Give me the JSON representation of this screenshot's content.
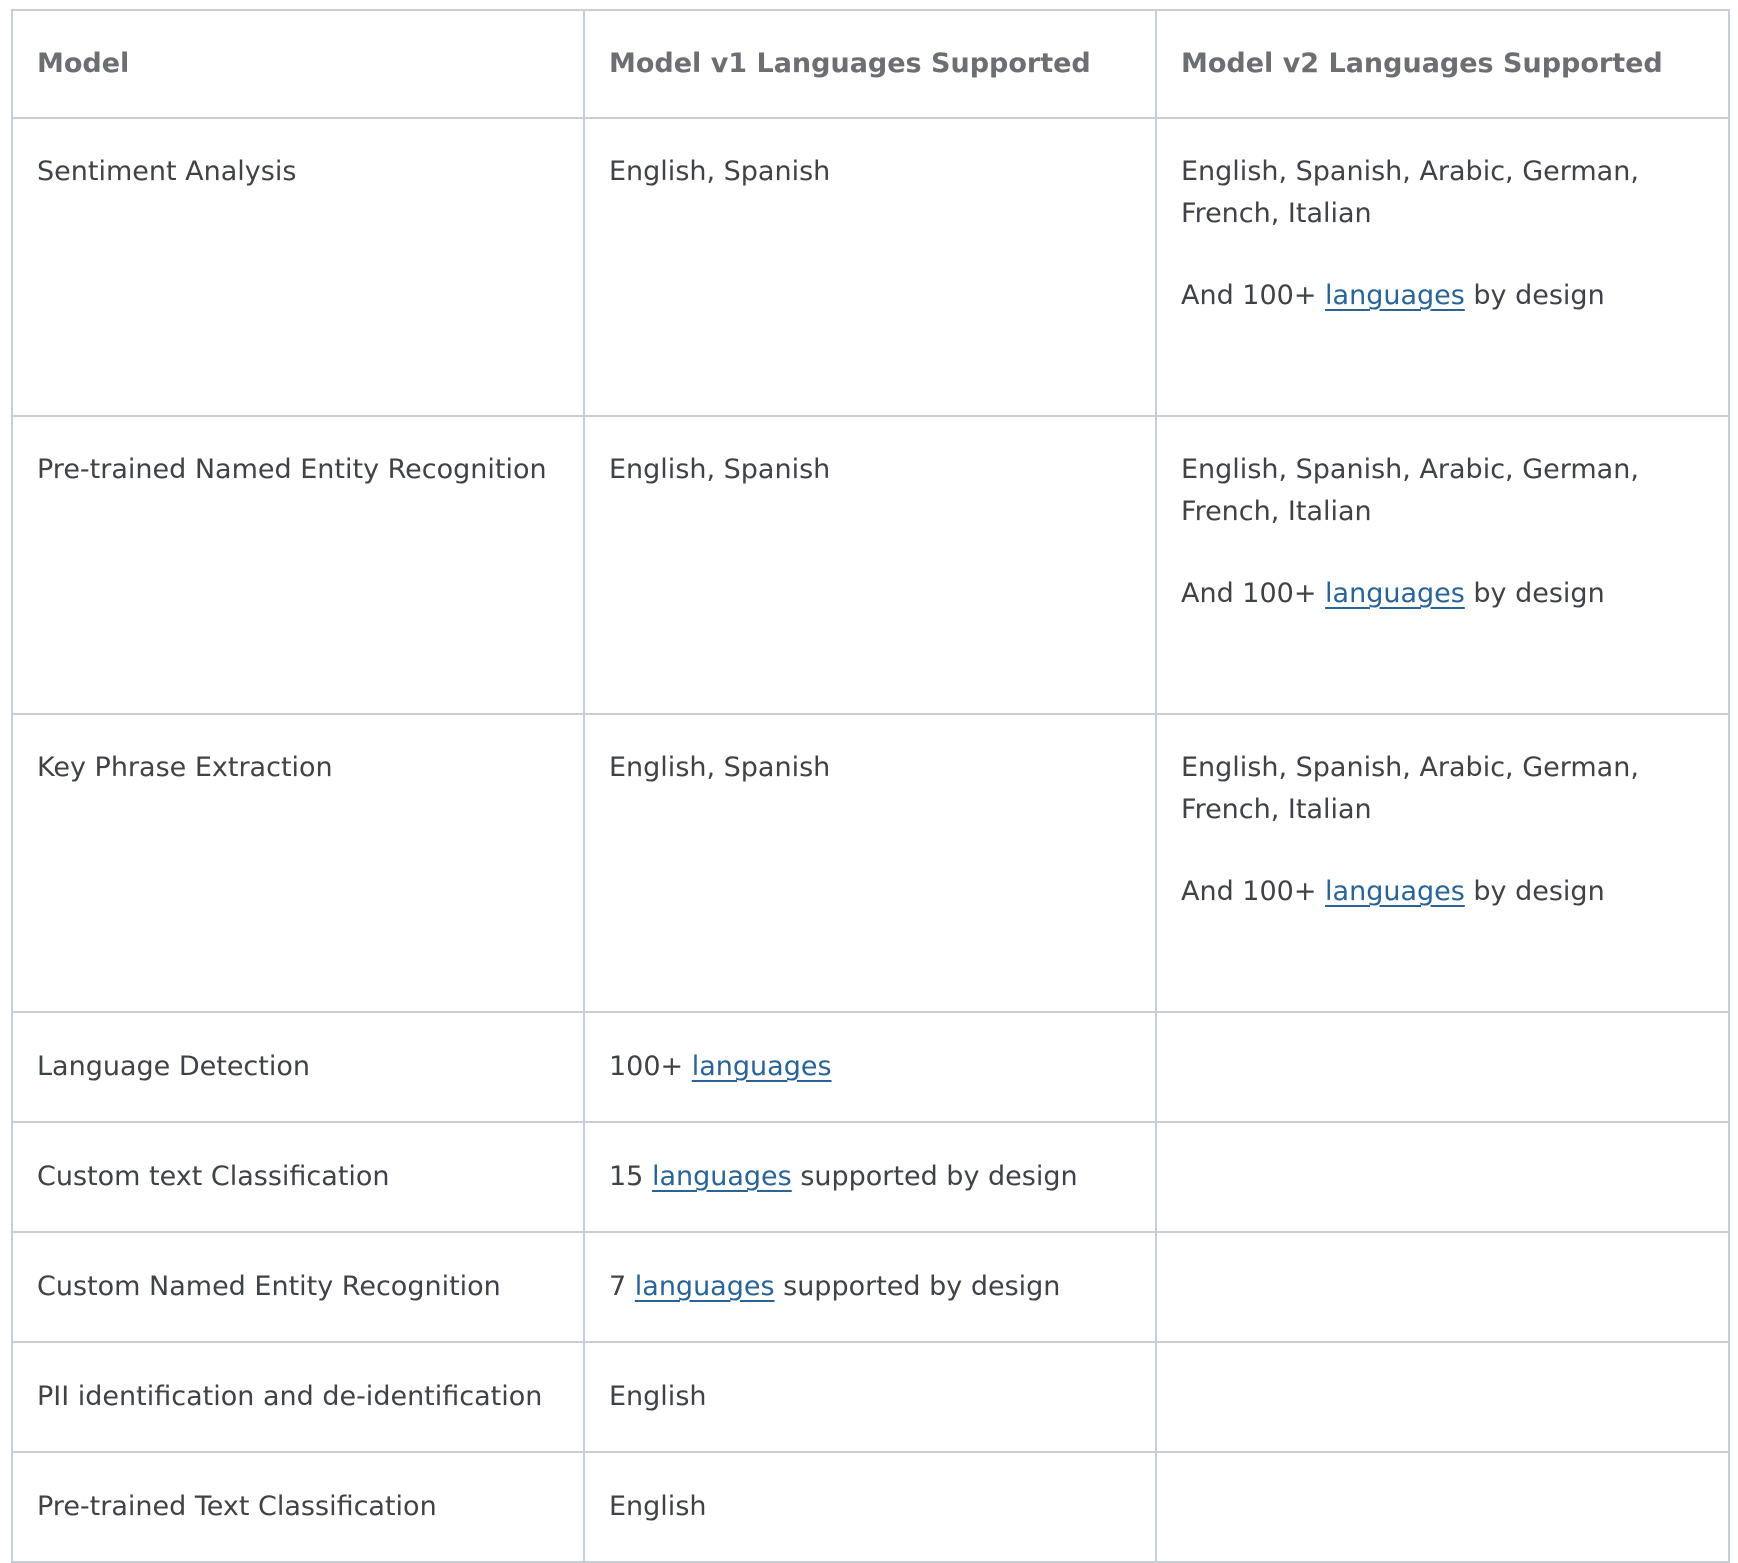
{
  "table": {
    "headers": [
      "Model",
      "Model v1 Languages Supported",
      "Model v2 Languages Supported"
    ],
    "rows": [
      {
        "model": "Sentiment Analysis",
        "v1": {
          "text": "English, Spanish"
        },
        "v2": {
          "text": "English, Spanish, Arabic, German, French, Italian",
          "extra": {
            "prefix": "And 100+ ",
            "link": "languages",
            "suffix": " by design"
          }
        }
      },
      {
        "model": "Pre-trained Named Entity Recognition",
        "v1": {
          "text": "English, Spanish"
        },
        "v2": {
          "text": "English, Spanish, Arabic, German, French, Italian",
          "extra": {
            "prefix": "And 100+ ",
            "link": "languages",
            "suffix": " by design"
          }
        }
      },
      {
        "model": "Key Phrase Extraction",
        "v1": {
          "text": "English, Spanish"
        },
        "v2": {
          "text": "English, Spanish, Arabic, German, French, Italian",
          "extra": {
            "prefix": "And 100+ ",
            "link": "languages",
            "suffix": " by design"
          }
        }
      },
      {
        "model": "Language Detection",
        "v1": {
          "prefix": "100+ ",
          "link": "languages",
          "suffix": ""
        },
        "v2": {
          "text": ""
        }
      },
      {
        "model": "Custom text Classification",
        "v1": {
          "prefix": "15 ",
          "link": "languages",
          "suffix": " supported by design"
        },
        "v2": {
          "text": ""
        }
      },
      {
        "model": "Custom Named Entity Recognition",
        "v1": {
          "prefix": "7 ",
          "link": "languages",
          "suffix": " supported by design"
        },
        "v2": {
          "text": ""
        }
      },
      {
        "model": "PII identification and de-identification",
        "v1": {
          "text": "English"
        },
        "v2": {
          "text": ""
        }
      },
      {
        "model": "Pre-trained Text Classification",
        "v1": {
          "text": "English"
        },
        "v2": {
          "text": ""
        }
      }
    ]
  }
}
